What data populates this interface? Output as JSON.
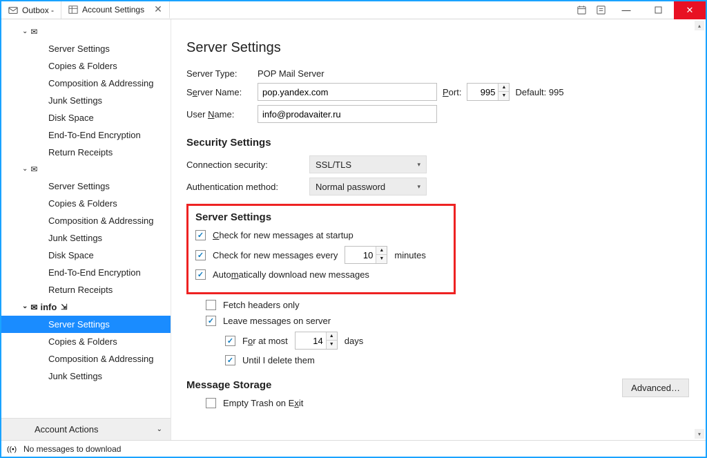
{
  "tabs": {
    "outbox": "Outbox -",
    "settings": "Account Settings"
  },
  "sidebar": {
    "account_label": "info",
    "items": {
      "server_settings": "Server Settings",
      "copies_folders": "Copies & Folders",
      "composition": "Composition & Addressing",
      "junk": "Junk Settings",
      "disk_space": "Disk Space",
      "e2e": "End-To-End Encryption",
      "return_receipts": "Return Receipts"
    },
    "account_actions": "Account Actions"
  },
  "page": {
    "title": "Server Settings",
    "server_type_label": "Server Type:",
    "server_type_value": "POP Mail Server",
    "server_name_label_pre": "S",
    "server_name_label_hot": "e",
    "server_name_label_post": "rver Name:",
    "server_name_value": "pop.yandex.com",
    "port_label_pre": "",
    "port_label_hot": "P",
    "port_label_post": "ort:",
    "port_value": "995",
    "default_port": "Default: 995",
    "user_name_label_pre": "User ",
    "user_name_label_hot": "N",
    "user_name_label_post": "ame:",
    "user_name_value": "info@prodavaiter.ru",
    "security_title": "Security Settings",
    "conn_sec_label": "Connection security:",
    "conn_sec_value": "SSL/TLS",
    "auth_label": "Authentication method:",
    "auth_value": "Normal password",
    "srv_settings_title": "Server Settings",
    "chk_startup_pre": "",
    "chk_startup_hot": "C",
    "chk_startup_post": "heck for new messages at startup",
    "chk_every_pre": "Check for new messages every",
    "chk_every_value": "10",
    "chk_every_unit": "minutes",
    "chk_auto_pre": "Auto",
    "chk_auto_hot": "m",
    "chk_auto_post": "atically download new messages",
    "chk_headers": "Fetch headers only",
    "chk_leave": "Leave messages on server",
    "chk_atmost_pre": "F",
    "chk_atmost_hot": "o",
    "chk_atmost_post": "r at most",
    "chk_atmost_value": "14",
    "chk_atmost_unit": "days",
    "chk_until": "Until I delete them",
    "msg_storage_title": "Message Storage",
    "empty_trash_pre": "Empty Trash on E",
    "empty_trash_hot": "x",
    "empty_trash_post": "it",
    "advanced": "Advanced…"
  },
  "status": {
    "msg": "No messages to download"
  }
}
